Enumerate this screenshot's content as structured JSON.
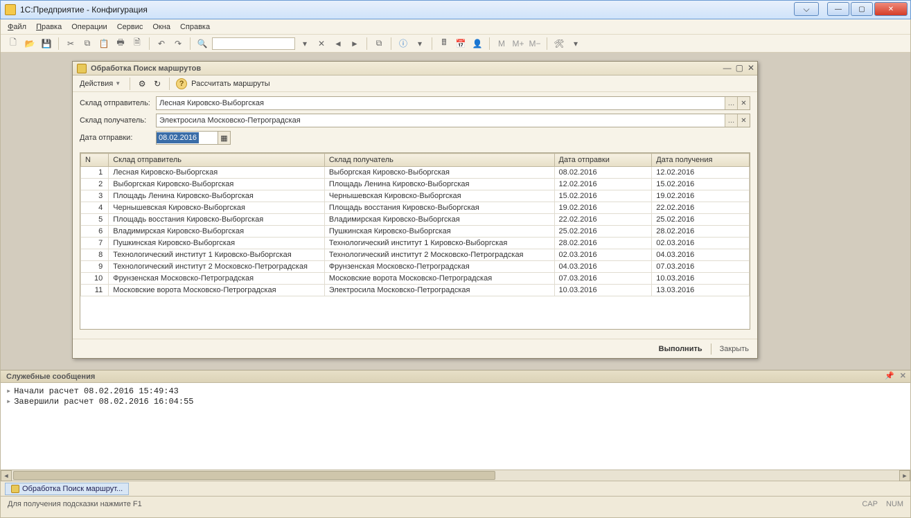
{
  "window": {
    "title": "1С:Предприятие - Конфигурация"
  },
  "menu": {
    "file": "Файл",
    "edit": "Правка",
    "ops": "Операции",
    "service": "Сервис",
    "windows": "Окна",
    "help": "Справка"
  },
  "dialog": {
    "title": "Обработка  Поиск маршрутов",
    "actions_label": "Действия",
    "calc_label": "Рассчитать маршруты",
    "sender_label": "Склад отправитель:",
    "sender_value": "Лесная Кировско-Выборгская",
    "receiver_label": "Склад получатель:",
    "receiver_value": "Электросила Московско-Петроградская",
    "date_label": "Дата отправки:",
    "date_value": "08.02.2016",
    "col_n": "N",
    "col_sender": "Склад отправитель",
    "col_receiver": "Склад получатель",
    "col_send": "Дата отправки",
    "col_recv": "Дата получения",
    "rows": [
      {
        "n": "1",
        "s": "Лесная Кировско-Выборгская",
        "r": "Выборгская Кировско-Выборгская",
        "d1": "08.02.2016",
        "d2": "12.02.2016"
      },
      {
        "n": "2",
        "s": "Выборгская Кировско-Выборгская",
        "r": "Площадь Ленина Кировско-Выборгская",
        "d1": "12.02.2016",
        "d2": "15.02.2016"
      },
      {
        "n": "3",
        "s": "Площадь Ленина Кировско-Выборгская",
        "r": "Чернышевская Кировско-Выборгская",
        "d1": "15.02.2016",
        "d2": "19.02.2016"
      },
      {
        "n": "4",
        "s": "Чернышевская Кировско-Выборгская",
        "r": "Площадь восстания Кировско-Выборгская",
        "d1": "19.02.2016",
        "d2": "22.02.2016"
      },
      {
        "n": "5",
        "s": "Площадь восстания Кировско-Выборгская",
        "r": "Владимирская Кировско-Выборгская",
        "d1": "22.02.2016",
        "d2": "25.02.2016"
      },
      {
        "n": "6",
        "s": "Владимирская Кировско-Выборгская",
        "r": "Пушкинская Кировско-Выборгская",
        "d1": "25.02.2016",
        "d2": "28.02.2016"
      },
      {
        "n": "7",
        "s": "Пушкинская Кировско-Выборгская",
        "r": "Технологический институт 1 Кировско-Выборгская",
        "d1": "28.02.2016",
        "d2": "02.03.2016"
      },
      {
        "n": "8",
        "s": "Технологический институт 1 Кировско-Выборгская",
        "r": "Технологический институт 2 Московско-Петроградская",
        "d1": "02.03.2016",
        "d2": "04.03.2016"
      },
      {
        "n": "9",
        "s": "Технологический институт 2 Московско-Петроградская",
        "r": "Фрунзенская Московско-Петроградская",
        "d1": "04.03.2016",
        "d2": "07.03.2016"
      },
      {
        "n": "10",
        "s": "Фрунзенская Московско-Петроградская",
        "r": "Московские ворота Московско-Петроградская",
        "d1": "07.03.2016",
        "d2": "10.03.2016"
      },
      {
        "n": "11",
        "s": "Московские ворота Московско-Петроградская",
        "r": "Электросила Московско-Петроградская",
        "d1": "10.03.2016",
        "d2": "13.03.2016"
      }
    ],
    "execute": "Выполнить",
    "close": "Закрыть"
  },
  "messages": {
    "title": "Служебные сообщения",
    "lines": [
      "Начали расчет 08.02.2016 15:49:43",
      "Завершили расчет 08.02.2016 16:04:55"
    ]
  },
  "task": {
    "label": "Обработка  Поиск маршрут..."
  },
  "status": {
    "hint": "Для получения подсказки нажмите F1",
    "cap": "CAP",
    "num": "NUM"
  }
}
